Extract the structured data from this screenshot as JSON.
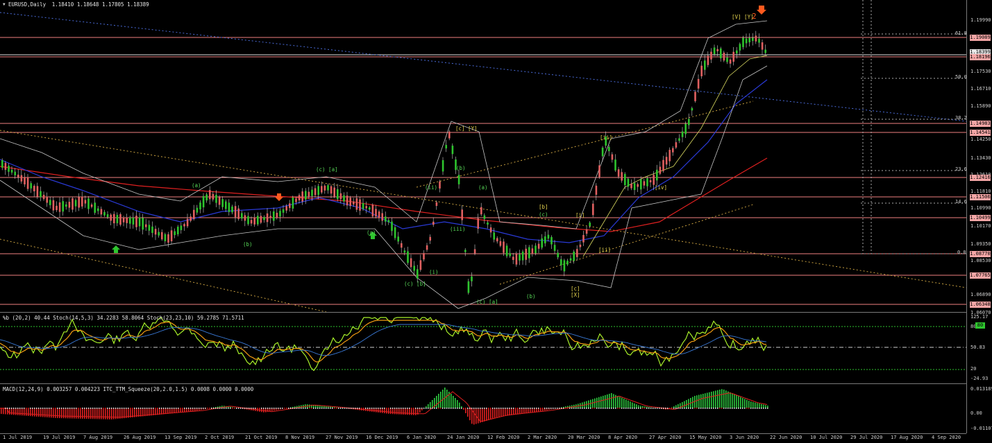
{
  "header": {
    "symbol": "EURUSD,Daily",
    "ohlc": "1.18410 1.18648 1.17805 1.18389"
  },
  "price_axis": {
    "labels": [
      "1.19990",
      "1.19089",
      "1.18399",
      "1.18196",
      "1.17530",
      "1.16710",
      "1.15890",
      "1.14983",
      "1.14541",
      "1.14250",
      "1.13430",
      "1.12610",
      "1.12416",
      "1.11810",
      "1.11506",
      "1.10990",
      "1.10499",
      "1.10170",
      "1.09350",
      "1.08770",
      "1.08530",
      "1.07765",
      "1.06890",
      "1.06348",
      "1.06070"
    ]
  },
  "fib_levels": [
    "61.8",
    "50.0",
    "38.2",
    "23.6",
    "14.6",
    "0.0"
  ],
  "wave_labels": {
    "top_left_group": "[V] [Y]",
    "top_right": "2",
    "c_c_y": "[c] [Y]",
    "ii": "[ii]",
    "iv": "[iv]",
    "b_bracket": "[b]",
    "c_paren": "(c)",
    "i_bracket": "[i]",
    "ii_bracket2": "[ii]",
    "c_x": "[c] [X]",
    "b_green": "(b)",
    "a_green": "(a)",
    "c_a": "(c) [a]",
    "b_paren2": "(b)",
    "a_paren2": "(a)",
    "c_b": "(c) [b]",
    "i_roman": "(i)",
    "ii_roman": "(ii)",
    "iii_roman": "(iii)",
    "c_a2": "(c) [a]",
    "b3": "(b)",
    "a3": "(a)"
  },
  "indicator1": {
    "title": "%b (20,2) 40.44  Stoch(14,5,3) 34.2283 58.8064  Stoch(23,23,10) 59.2785 71.5711",
    "axis_labels": [
      "125.17",
      "80",
      "50.83",
      "20",
      "-24.93"
    ],
    "tag_value": "80"
  },
  "indicator2": {
    "title": "MACD(12,24,9) 0.003257 0.004223  ITC_TTM_Squeeze(20,2.0,1.5) 0.0008 0.0000 0.0000",
    "axis_labels": [
      "0.013189",
      "0.00",
      "-0.011070"
    ]
  },
  "time_axis": {
    "labels": [
      "1 Jul 2019",
      "19 Jul 2019",
      "7 Aug 2019",
      "26 Aug 2019",
      "13 Sep 2019",
      "2 Oct 2019",
      "21 Oct 2019",
      "8 Nov 2019",
      "27 Nov 2019",
      "16 Dec 2019",
      "6 Jan 2020",
      "24 Jan 2020",
      "12 Feb 2020",
      "2 Mar 2020",
      "20 Mar 2020",
      "8 Apr 2020",
      "27 Apr 2020",
      "15 May 2020",
      "3 Jun 2020",
      "22 Jun 2020",
      "10 Jul 2020",
      "29 Jul 2020",
      "17 Aug 2020",
      "4 Sep 2020"
    ]
  },
  "colors": {
    "background": "#000000",
    "resistance_line": "#f08080",
    "bull_candle": "#2ec52e",
    "bear_candle": "#e06060",
    "ema_red": "#e02020",
    "ema_blue": "#2a3ad8",
    "bollinger": "#c8c8c8",
    "stoch_green": "#a8f02a",
    "stoch_orange": "#f39c12",
    "macd_green": "#2ecc40",
    "macd_red": "#e02020"
  }
}
